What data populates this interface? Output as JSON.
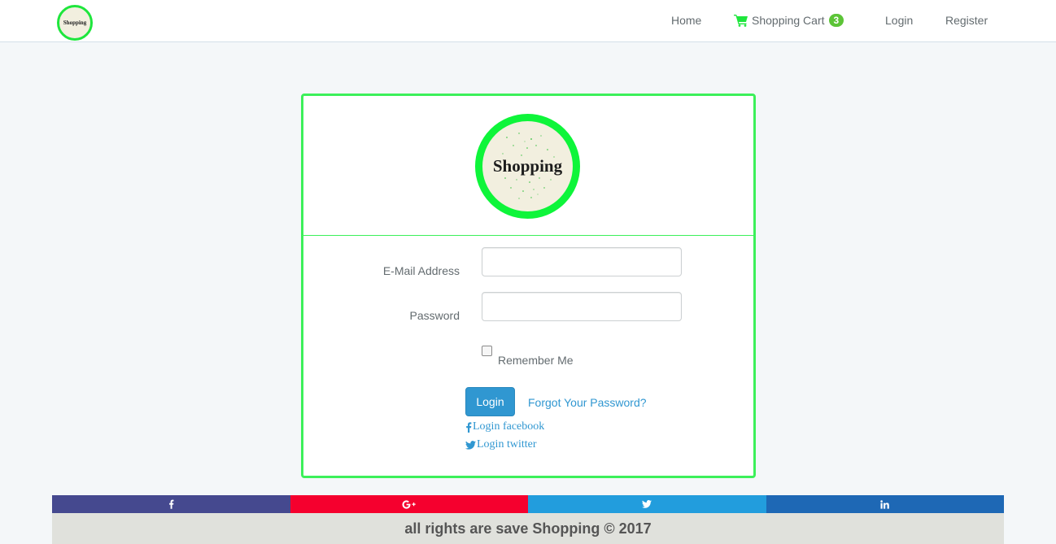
{
  "navbar": {
    "brand_logo_text": "Shopping",
    "links": {
      "home": "Home",
      "cart": "Shopping Cart",
      "cart_count": "3",
      "login": "Login",
      "register": "Register"
    },
    "cart_icon": "shopping-cart-icon"
  },
  "panel": {
    "logo_text": "Shopping",
    "email_label": "E-Mail Address",
    "email_value": "",
    "password_label": "Password",
    "password_value": "",
    "remember_label": "Remember Me",
    "remember_checked": false,
    "login_button": "Login",
    "forgot_link": "Forgot Your Password?",
    "facebook_link": "Login facebook",
    "twitter_link": "Login twitter"
  },
  "share": [
    {
      "name": "facebook",
      "icon": "facebook-icon",
      "color": "#45498f"
    },
    {
      "name": "google-plus",
      "icon": "google-plus-icon",
      "color": "#f5002e"
    },
    {
      "name": "twitter",
      "icon": "twitter-icon",
      "color": "#229ddd"
    },
    {
      "name": "linkedin",
      "icon": "linkedin-icon",
      "color": "#1e68b5"
    }
  ],
  "footer": {
    "text": "all rights are save Shopping © 2017"
  },
  "colors": {
    "accent_green": "#1ee63c",
    "link_blue": "#3097d1",
    "badge_green": "#5cc437"
  }
}
